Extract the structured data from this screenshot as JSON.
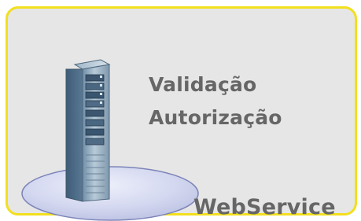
{
  "panel": {
    "border_color": "#f2df1e",
    "background_color": "#e6e6e6"
  },
  "server": {
    "icon": "server-tower-icon",
    "base_icon": "platform-ellipse-icon"
  },
  "labels": {
    "validacao": "Validação",
    "autorizacao": "Autorização",
    "webservice": "WebService"
  },
  "text_color": "#666666"
}
